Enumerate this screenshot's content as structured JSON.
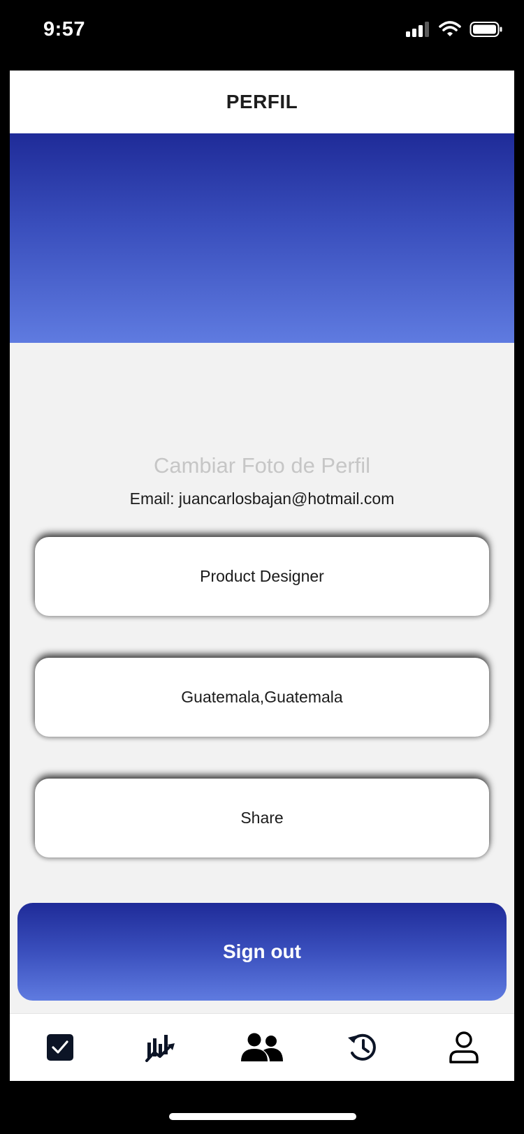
{
  "status_bar": {
    "time": "9:57"
  },
  "header": {
    "title": "PERFIL"
  },
  "profile": {
    "change_photo_label": "Cambiar Foto de Perfil",
    "email_label": "Email: juancarlosbajan@hotmail.com"
  },
  "cards": [
    {
      "label": "Product Designer"
    },
    {
      "label": "Guatemala,Guatemala"
    },
    {
      "label": "Share"
    }
  ],
  "signout": {
    "label": "Sign out"
  },
  "tabbar": {
    "items": [
      {
        "icon": "checkbox-icon"
      },
      {
        "icon": "trending-chart-icon"
      },
      {
        "icon": "users-icon"
      },
      {
        "icon": "history-icon"
      },
      {
        "icon": "user-icon"
      }
    ]
  },
  "colors": {
    "gradient_top": "#1f2b98",
    "gradient_bottom": "#5f7be0",
    "background": "#f2f2f2",
    "placeholder_text": "#c6c6c6"
  }
}
